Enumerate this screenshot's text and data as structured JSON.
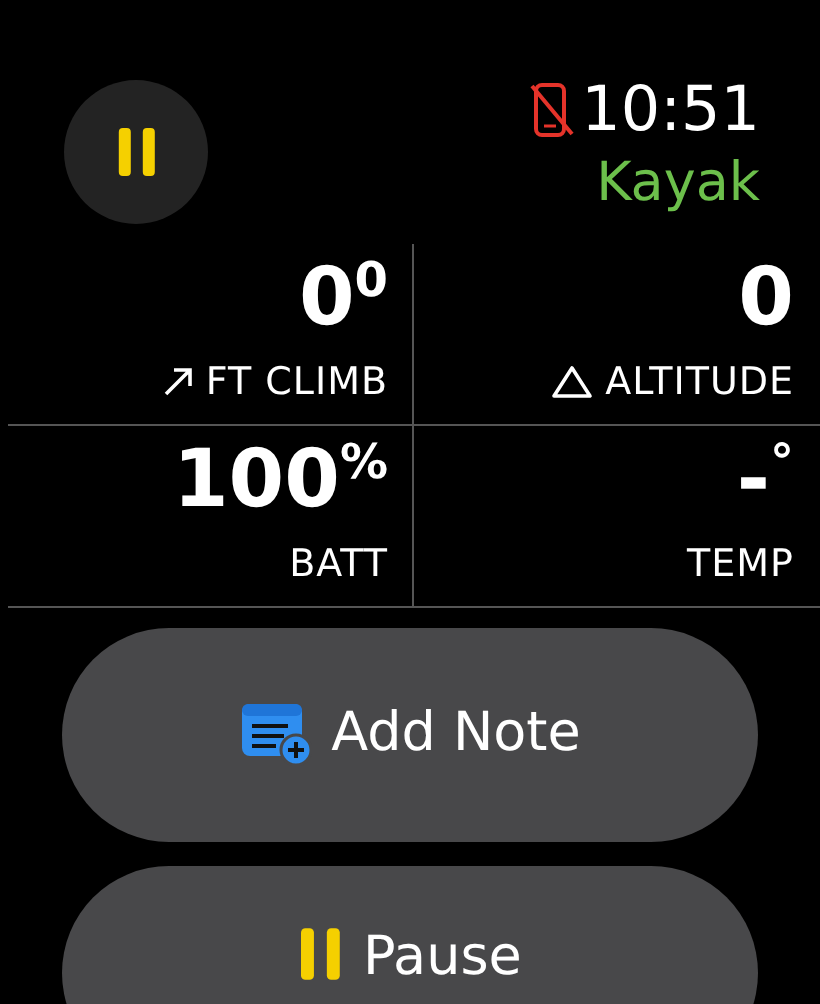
{
  "status": {
    "paused": true,
    "phone_disconnected": true,
    "time": "10:51",
    "workout": "Kayak"
  },
  "metrics": [
    {
      "value": "0$^{0}$",
      "label": "FT CLIMB",
      "kind": "climb"
    },
    {
      "value": "0",
      "label": "ALTITUDE",
      "kind": "altitude"
    },
    {
      "value": "100$^{%}$",
      "label": "BATT",
      "kind": "plain"
    },
    {
      "value": "-$^{°}$",
      "label": "TEMP",
      "kind": "plain"
    }
  ],
  "actions": [
    {
      "label": "Add Note",
      "kind": "note"
    },
    {
      "label": "Pause",
      "kind": "pause"
    }
  ]
}
